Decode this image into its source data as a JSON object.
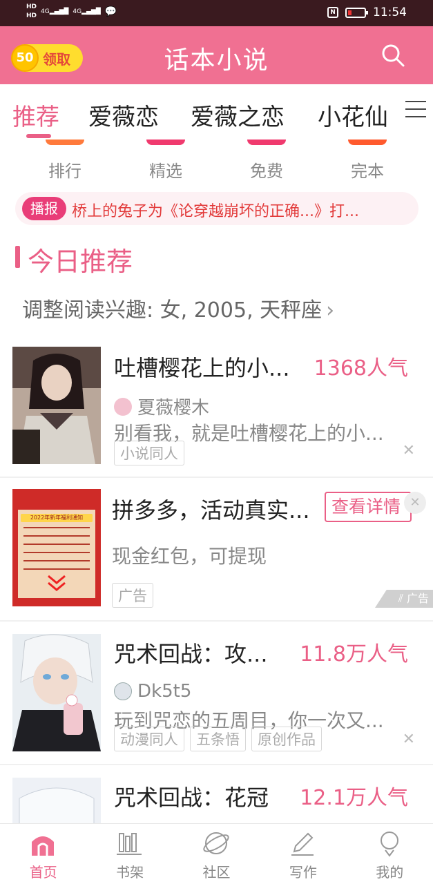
{
  "status_bar": {
    "left_hd1": "HD",
    "left_hd2": "HD",
    "signal1": "4G",
    "signal2": "4G",
    "nfc": "N",
    "time": "11:54"
  },
  "header": {
    "coin_value": "50",
    "coin_label": "领取",
    "title": "话本小说",
    "search_icon": "search-icon"
  },
  "tabs": [
    {
      "label": "推荐",
      "active": true
    },
    {
      "label": "爱薇恋",
      "active": false
    },
    {
      "label": "爱薇之恋",
      "active": false
    },
    {
      "label": "小花仙",
      "active": false
    }
  ],
  "quick_entries": [
    {
      "label": "排行",
      "color": "#ff7a3c"
    },
    {
      "label": "精选",
      "color": "#f03a6e"
    },
    {
      "label": "免费",
      "color": "#f03a6e"
    },
    {
      "label": "完本",
      "color": "#ff5a2e"
    }
  ],
  "ticker": {
    "badge": "播报",
    "text": "桥上的兔子为《论穿越崩坏的正确...》打..."
  },
  "section": {
    "title": "今日推荐",
    "interest": "调整阅读兴趣: 女, 2005, 天秤座",
    "chevron": "›"
  },
  "feed": [
    {
      "title": "吐槽樱花上的小...",
      "popularity": "1368人气",
      "author": "夏薇樱木",
      "desc": "别看我，就是吐槽樱花上的小...",
      "tags": [
        "小说同人"
      ],
      "close": "✕"
    },
    {
      "title": "拼多多，活动真实...",
      "button": "查看详情",
      "desc": "现金红包，可提现",
      "tags": [
        "广告"
      ],
      "ad_mark": "广告",
      "close": "✕",
      "poster_title": "2022年新年福利通知"
    },
    {
      "title": "咒术回战：攻...",
      "popularity": "11.8万人气",
      "author": "Dk5t5",
      "desc": "玩到咒恋的五周目，你一次又...",
      "tags": [
        "动漫同人",
        "五条悟",
        "原创作品"
      ],
      "close": "✕"
    },
    {
      "title": "咒术回战：花冠",
      "popularity": "12.1万人气"
    }
  ],
  "bottom_nav": [
    {
      "label": "首页",
      "icon": "home-icon",
      "active": true
    },
    {
      "label": "书架",
      "icon": "bookshelf-icon",
      "active": false
    },
    {
      "label": "社区",
      "icon": "community-icon",
      "active": false
    },
    {
      "label": "写作",
      "icon": "pen-icon",
      "active": false
    },
    {
      "label": "我的",
      "icon": "profile-icon",
      "active": false
    }
  ],
  "colors": {
    "brand_pink": "#f07092",
    "accent_pink": "#ea5f86",
    "status_bar": "#3a1a1f",
    "coin_yellow": "#ffdd2e"
  }
}
